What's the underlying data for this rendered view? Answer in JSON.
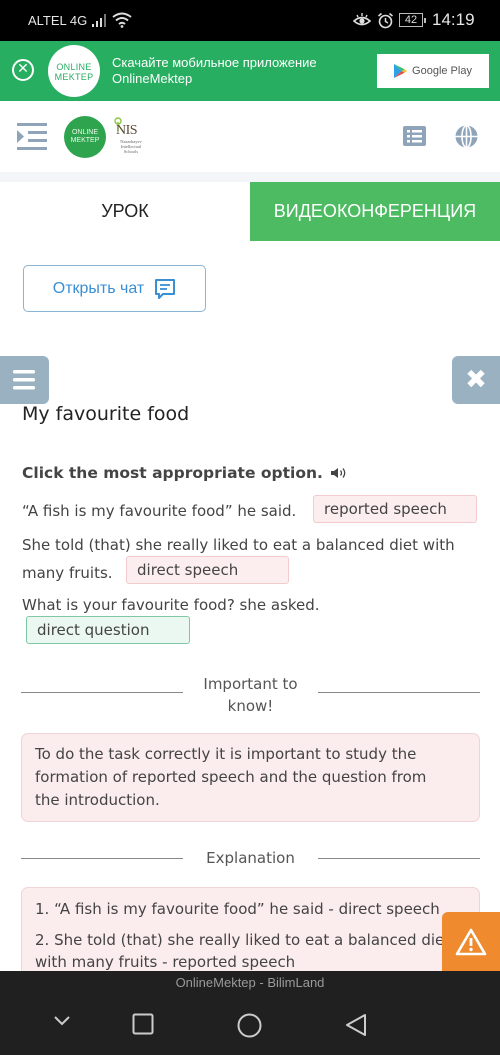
{
  "status_bar": {
    "carrier": "ALTEL 4G",
    "battery": "42",
    "time": "14:19"
  },
  "app_banner": {
    "logo_line1": "ONLINE",
    "logo_line2": "MEKTEP",
    "text_line1": "Скачайте мобильное приложение",
    "text_line2": "OnlineMektep",
    "store_button": "Google Play"
  },
  "top_nav": {
    "logo_line1": "ONLINE",
    "logo_line2": "MEKTEP",
    "nis_name": "NIS",
    "nis_sub": "Nazarbayev Intellectual Schools"
  },
  "tabs": [
    {
      "label": "УРОК",
      "active": true
    },
    {
      "label": "ВИДЕОКОНФЕРЕНЦИЯ",
      "active": false
    }
  ],
  "open_chat_label": "Открыть чат",
  "lesson": {
    "title": "My favourite food",
    "instruction": "Click the most appropriate option.",
    "items": [
      {
        "sentence": "“A fish is my favourite food” he said.",
        "answer": "reported speech",
        "status": "wrong"
      },
      {
        "sentence_line1": "She told (that) she really liked to eat a balanced diet with",
        "sentence_line2": "many fruits.",
        "answer": "direct speech",
        "status": "wrong"
      },
      {
        "sentence": "What is your favourite food? she asked.",
        "answer": "direct question",
        "status": "correct"
      }
    ]
  },
  "important": {
    "label_line1": "Important to",
    "label_line2": "know!",
    "text_line1": "To do the task correctly it is important to study the",
    "text_line2": "formation of reported speech and the question from",
    "text_line3": "the introduction."
  },
  "explanation": {
    "label": "Explanation",
    "line1": "1. “A fish is my favourite food” he said - direct speech",
    "line2": "2. She told (that) she really liked to eat a balanced diet",
    "line3": "with many fruits - reported speech"
  },
  "bottom_bar": {
    "app_name": "OnlineMektep - BilimLand"
  },
  "colors": {
    "brand_green": "#27ae60",
    "tab_green": "#4cbb62",
    "wrong_bg": "#fceeee",
    "correct_bg": "#eaf8f1",
    "warning_orange": "#ef8a2e",
    "side_button": "#9ab1c1"
  }
}
